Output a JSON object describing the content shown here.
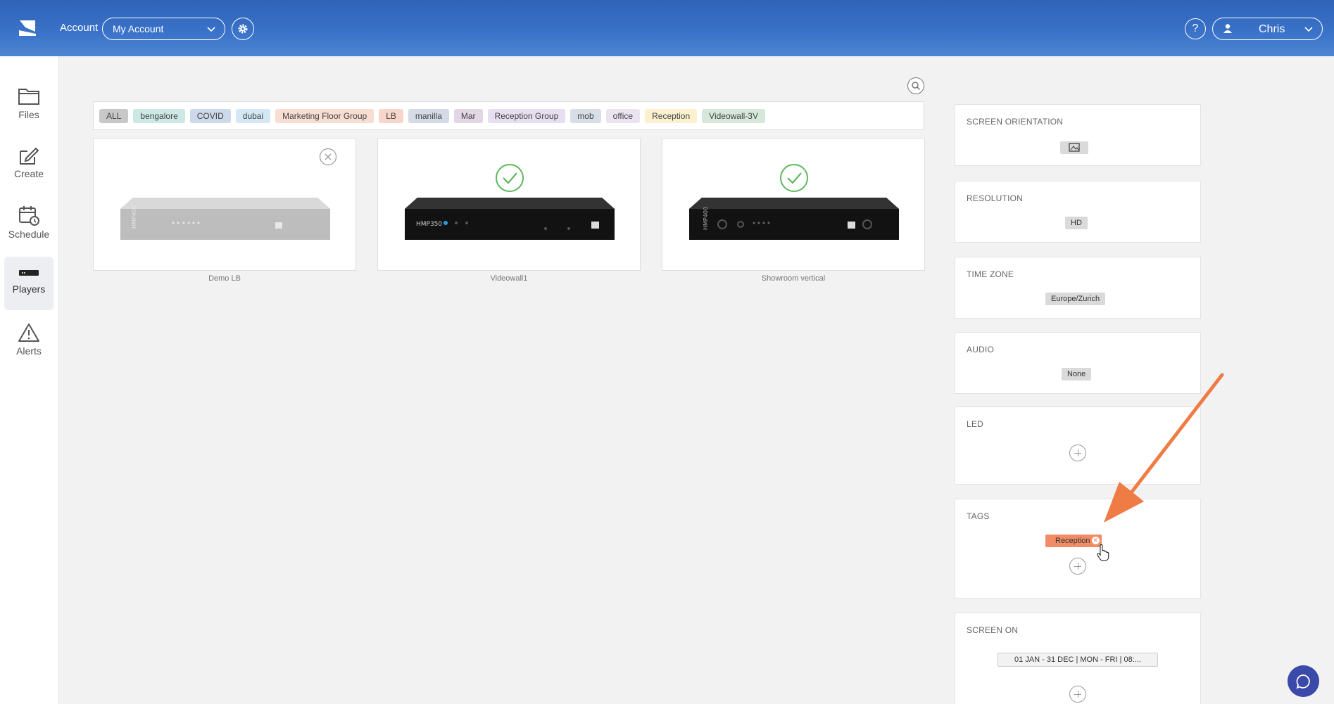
{
  "header": {
    "account_label": "Account",
    "account_select": "My Account",
    "help_label": "?",
    "user_name": "Chris",
    "colors": {
      "header": "#3a73c9"
    }
  },
  "sidebar": {
    "items": [
      {
        "label": "Files",
        "icon": "folder-icon"
      },
      {
        "label": "Create",
        "icon": "edit-icon"
      },
      {
        "label": "Schedule",
        "icon": "calendar-clock-icon"
      },
      {
        "label": "Players",
        "icon": "player-icon",
        "active": true
      },
      {
        "label": "Alerts",
        "icon": "warning-icon"
      }
    ]
  },
  "tags": [
    {
      "label": "ALL",
      "color": "#c8c8c8"
    },
    {
      "label": "bengalore",
      "color": "#cde9e6"
    },
    {
      "label": "COVID",
      "color": "#cdd9ea"
    },
    {
      "label": "dubai",
      "color": "#d3e8f4"
    },
    {
      "label": "Marketing Floor Group",
      "color": "#f8ddd2"
    },
    {
      "label": "LB",
      "color": "#f8d6cb"
    },
    {
      "label": "manilla",
      "color": "#d5dbe6"
    },
    {
      "label": "Mar",
      "color": "#e3d6e6"
    },
    {
      "label": "Reception Group",
      "color": "#e7dff0"
    },
    {
      "label": "mob",
      "color": "#d8dee6"
    },
    {
      "label": "office",
      "color": "#ece3f2"
    },
    {
      "label": "Reception",
      "color": "#fbf1cf"
    },
    {
      "label": "Videowall-3V",
      "color": "#d6e8da"
    }
  ],
  "players": [
    {
      "name": "Demo LB",
      "model": "HMP400",
      "status": "unselected"
    },
    {
      "name": "Videowall1",
      "model": "HMP350",
      "status": "selected"
    },
    {
      "name": "Showroom vertical",
      "model": "HMP400",
      "status": "selected"
    }
  ],
  "panels": {
    "orientation": {
      "title": "SCREEN ORIENTATION",
      "icon": "landscape-icon"
    },
    "resolution": {
      "title": "RESOLUTION",
      "value": "HD"
    },
    "timezone": {
      "title": "TIME ZONE",
      "value": "Europe/Zurich"
    },
    "audio": {
      "title": "AUDIO",
      "value": "None"
    },
    "led": {
      "title": "LED"
    },
    "tags": {
      "title": "TAGS",
      "value": "Reception",
      "tag_color": "#f08c66"
    },
    "screen_on": {
      "title": "SCREEN ON",
      "value": "01 JAN - 31 DEC | MON - FRI | 08:..."
    }
  }
}
